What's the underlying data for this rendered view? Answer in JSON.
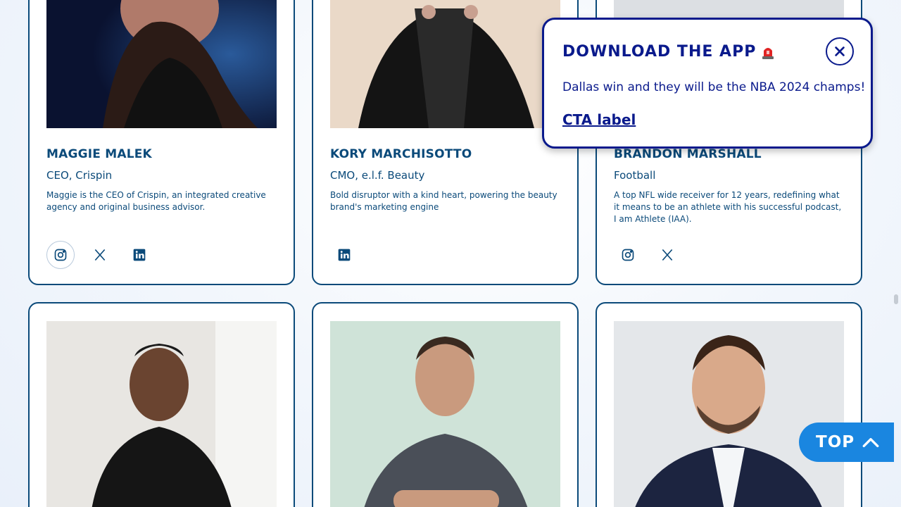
{
  "people": [
    {
      "name": "MAGGIE MALEK",
      "role": "CEO, Crispin",
      "bio": "Maggie is the CEO of Crispin, an integrated creative agency and original business advisor.",
      "socials": [
        "instagram-icon",
        "x-icon",
        "linkedin-icon"
      ]
    },
    {
      "name": "KORY MARCHISOTTO",
      "role": "CMO, e.l.f. Beauty",
      "bio": "Bold disruptor with a kind heart, powering the beauty brand's marketing engine",
      "socials": [
        "linkedin-icon"
      ]
    },
    {
      "name": "BRANDON MARSHALL",
      "role": "Football",
      "bio": "A top NFL wide receiver for 12 years, redefining what it means to be an athlete with his successful podcast, I am Athlete (IAA).",
      "socials": [
        "instagram-icon",
        "x-icon"
      ]
    }
  ],
  "popup": {
    "title": "DOWNLOAD THE APP",
    "title_emoji": "siren-icon",
    "message": "Dallas win and they will be the NBA 2024 champs!",
    "cta": "CTA label"
  },
  "top_button": {
    "label": "TOP"
  },
  "colors": {
    "brand_navy": "#0b4a7a",
    "popup_navy": "#0a1a8c",
    "top_button_blue": "#1a86e0"
  }
}
